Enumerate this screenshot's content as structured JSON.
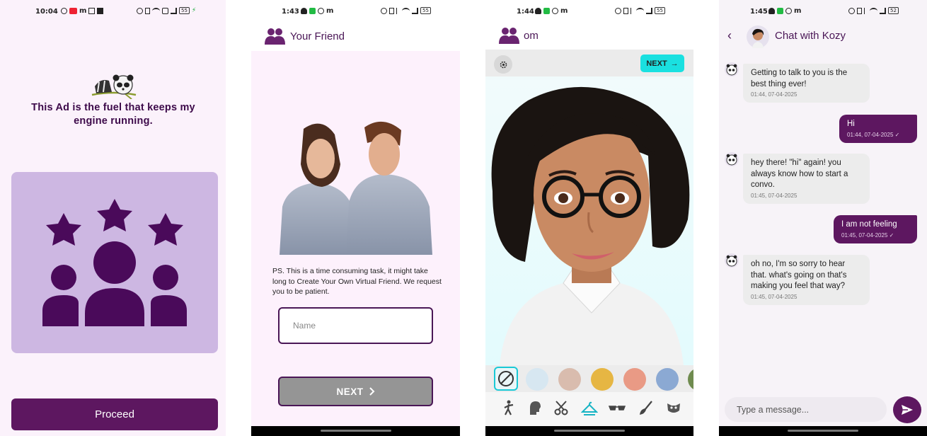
{
  "screen1": {
    "time": "10:04",
    "battery": "55",
    "ad_text": "This Ad is the fuel that keeps my engine running.",
    "proceed_label": "Proceed",
    "colors": {
      "card": "#cdb7e2",
      "icon": "#4a0a5a",
      "button": "#5d1760"
    }
  },
  "screen2": {
    "time": "1:43",
    "battery": "55",
    "title": "Your Friend",
    "ps_text": "PS. This is a time consuming task, it might take long to Create Your Own Virtual Friend. We request you to be patient.",
    "name_placeholder": "Name",
    "next_label": "NEXT"
  },
  "screen3": {
    "time": "1:44",
    "battery": "55",
    "title": "om",
    "next_label": "NEXT",
    "swatch_colors": [
      "#d7e7f1",
      "#d9bcae",
      "#e6b643",
      "#e99a85",
      "#8ba9d3",
      "#6f8b4f"
    ],
    "tools": [
      "pose-icon",
      "head-icon",
      "hair-scissors-icon",
      "clothes-hanger-icon",
      "glasses-icon",
      "makeup-brush-icon",
      "mask-icon"
    ]
  },
  "screen4": {
    "time": "1:45",
    "battery": "52",
    "title": "Chat with Kozy",
    "messages": [
      {
        "from": "bot",
        "text": "Getting to talk to you is the best thing ever!",
        "ts": "01:44, 07-04-2025"
      },
      {
        "from": "me",
        "text": "Hi",
        "ts": "01:44, 07-04-2025 ✓"
      },
      {
        "from": "bot",
        "text": "hey there! \"hi\" again! you always know how to start a convo.",
        "ts": "01:45, 07-04-2025"
      },
      {
        "from": "me",
        "text": "I am not feeling",
        "ts": "01:45, 07-04-2025 ✓"
      },
      {
        "from": "bot",
        "text": "oh no, I'm so sorry to hear that. what's going on that's making you feel that way?",
        "ts": "01:45, 07-04-2025"
      }
    ],
    "input_placeholder": "Type a message..."
  }
}
